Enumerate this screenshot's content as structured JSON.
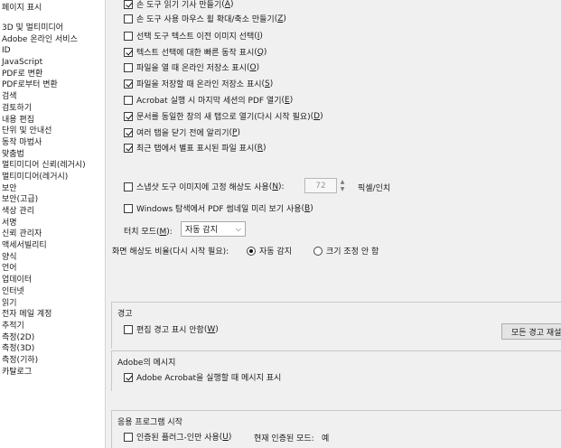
{
  "sidebar": {
    "top_item": "페이지 표시",
    "items": [
      "3D 및 멀티미디어",
      "Adobe 온라인 서비스",
      "ID",
      "JavaScript",
      "PDF로 변환",
      "PDF로부터 변환",
      "검색",
      "검토하기",
      "내용 편집",
      "단위 및 안내선",
      "동작 마법사",
      "맞춤법",
      "멀티미디어 신뢰(레거시)",
      "멀티미디어(레거시)",
      "보안",
      "보안(고급)",
      "색상 관리",
      "서명",
      "신뢰 관리자",
      "액세서빌리티",
      "양식",
      "언어",
      "업데이터",
      "인터넷",
      "읽기",
      "전자 메일 계정",
      "추적기",
      "측정(2D)",
      "측정(3D)",
      "측정(기하)",
      "카탈로그"
    ]
  },
  "general": {
    "checkboxes": [
      {
        "label": "손 도구 읽기 기사 만들기",
        "key": "A",
        "checked": true
      },
      {
        "label": "손 도구 사용 마우스 휠 확대/축소 만들기",
        "key": "Z",
        "checked": false
      },
      {
        "label": "선택 도구 텍스트 이전 이미지 선택",
        "key": "I",
        "checked": false
      },
      {
        "label": "텍스트 선택에 대한 빠른 동작 표시",
        "key": "Q",
        "checked": true
      },
      {
        "label": "파일을 열 때 온라인 저장소 표시",
        "key": "O",
        "checked": false
      },
      {
        "label": "파일을 저장할 때 온라인 저장소 표시",
        "key": "S",
        "checked": true
      },
      {
        "label": "Acrobat 실행 시 마지막 세션의 PDF 열기",
        "key": "E",
        "checked": false
      },
      {
        "label": "문서를 동일한 창의 새 탭으로 열기(다시 시작 필요)",
        "key": "D",
        "checked": true
      },
      {
        "label": "여러 탭을 닫기 전에 알리기",
        "key": "P",
        "checked": true
      },
      {
        "label": "최근 탭에서 별표 표시된 파일 표시",
        "key": "R",
        "checked": true
      }
    ],
    "snapshot": {
      "label": "스냅샷 도구 이미지에 고정 해상도 사용",
      "key": "N",
      "checked": false,
      "value": "72",
      "unit": "픽셀/인치"
    },
    "thumbnail": {
      "label": "Windows 탐색에서 PDF 썸네일 미리 보기 사용",
      "key": "B",
      "checked": false
    },
    "touch_mode": {
      "label": "터치 모드",
      "key": "M",
      "selected": "자동 감지"
    },
    "resolution": {
      "label": "화면 해상도 비율(다시 시작 필요):",
      "options": [
        {
          "label": "자동 감지",
          "selected": true
        },
        {
          "label": "크기 조정 안 함",
          "selected": false
        }
      ]
    }
  },
  "warnings": {
    "title": "경고",
    "checkbox": {
      "label": "편집 경고 표시 안함",
      "key": "W",
      "checked": false
    },
    "reset_button": "모든 경고 재설정"
  },
  "adobe_messages": {
    "title": "Adobe의 메시지",
    "checkbox": {
      "label": "Adobe Acrobat을 실행할 때 메시지 표시",
      "checked": true
    }
  },
  "app_startup": {
    "title": "응용 프로그램 시작",
    "checkbox": {
      "label": "인증된 플러그-인만 사용",
      "key": "U",
      "checked": false
    },
    "certified_label": "현재 인증된 모드:",
    "certified_value": "예"
  }
}
